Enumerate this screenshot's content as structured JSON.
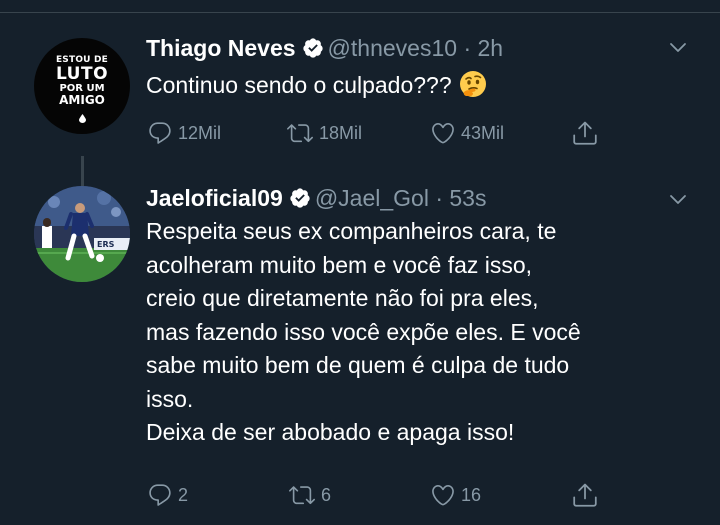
{
  "tweets": [
    {
      "name": "Thiago Neves",
      "handle": "@thneves10",
      "separator": "·",
      "time": "2h",
      "avatar_text": [
        "ESTOU DE",
        "LUTO",
        "POR UM",
        "AMIGO"
      ],
      "lines": [
        "Continuo sendo o culpado???"
      ],
      "emoji": "thinking-face",
      "replies": "12Mil",
      "retweets": "18Mil",
      "likes": "43Mil"
    },
    {
      "name": "Jaeloficial09",
      "handle": "@Jael_Gol",
      "separator": "·",
      "time": "53s",
      "lines": [
        "Respeita seus ex companheiros cara, te",
        "acolheram muito bem e você faz isso,",
        "creio que diretamente não foi pra eles,",
        "mas fazendo isso você expõe eles. E você",
        "sabe muito bem de quem é culpa de tudo",
        "isso.",
        "Deixa de ser abobado e apaga isso!"
      ],
      "replies": "2",
      "retweets": "6",
      "likes": "16"
    }
  ],
  "colors": {
    "background": "#15202b",
    "secondary_text": "#8899a6",
    "primary_text": "#ffffff",
    "divider": "#38444d"
  }
}
